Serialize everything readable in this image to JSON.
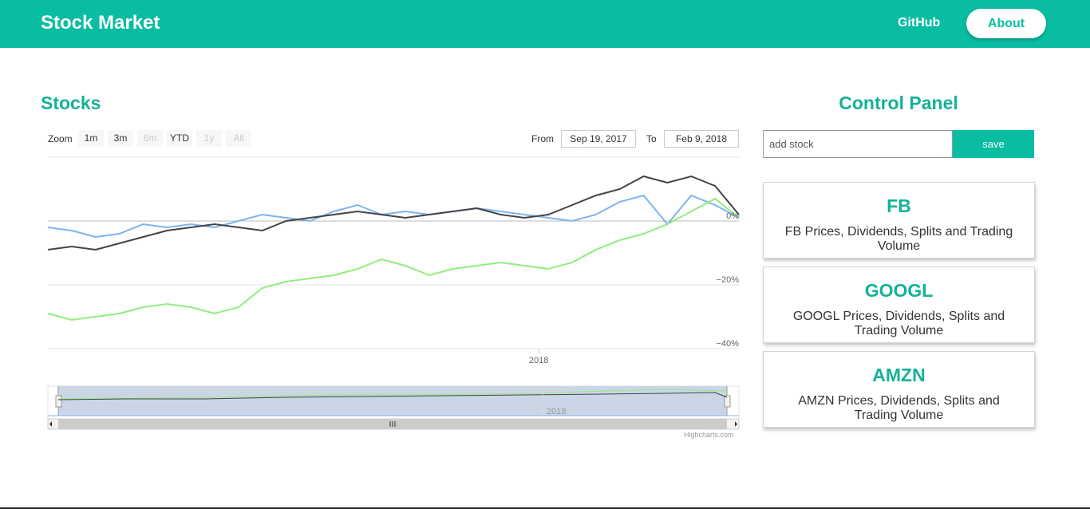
{
  "header": {
    "brand": "Stock Market",
    "nav_github": "GitHub",
    "nav_about": "About"
  },
  "stocks_title": "Stocks",
  "chart": {
    "zoom_label": "Zoom",
    "zoom_buttons": [
      {
        "label": "1m",
        "enabled": true
      },
      {
        "label": "3m",
        "enabled": true
      },
      {
        "label": "6m",
        "enabled": false
      },
      {
        "label": "YTD",
        "enabled": true
      },
      {
        "label": "1y",
        "enabled": false
      },
      {
        "label": "All",
        "enabled": false
      }
    ],
    "from_label": "From",
    "from_value": "Sep 19, 2017",
    "to_label": "To",
    "to_value": "Feb 9, 2018",
    "credits": "Highcharts.com",
    "navigator_label": "2018"
  },
  "chart_data": {
    "type": "line",
    "x": [
      "2017-09-19",
      "2017-09-24",
      "2017-09-29",
      "2017-10-04",
      "2017-10-09",
      "2017-10-14",
      "2017-10-19",
      "2017-10-24",
      "2017-10-29",
      "2017-11-03",
      "2017-11-08",
      "2017-11-13",
      "2017-11-18",
      "2017-11-23",
      "2017-11-28",
      "2017-12-03",
      "2017-12-08",
      "2017-12-13",
      "2017-12-18",
      "2017-12-23",
      "2017-12-28",
      "2018-01-02",
      "2018-01-07",
      "2018-01-12",
      "2018-01-17",
      "2018-01-22",
      "2018-01-27",
      "2018-02-01",
      "2018-02-04",
      "2018-02-09"
    ],
    "series": [
      {
        "color": "#7cb5ec",
        "values": [
          -2,
          -3,
          -5,
          -4,
          -1,
          -2,
          -1,
          -2,
          0,
          2,
          1,
          0,
          3,
          5,
          2,
          3,
          2,
          3,
          4,
          3,
          2,
          1,
          0,
          2,
          6,
          8,
          -1,
          8,
          5,
          1
        ]
      },
      {
        "color": "#434348",
        "values": [
          -9,
          -8,
          -9,
          -7,
          -5,
          -3,
          -2,
          -1,
          -2,
          -3,
          0,
          1,
          2,
          3,
          2,
          1,
          2,
          3,
          4,
          2,
          1,
          2,
          5,
          8,
          10,
          14,
          12,
          14,
          11,
          2
        ]
      },
      {
        "color": "#90ed7d",
        "values": [
          -29,
          -31,
          -30,
          -29,
          -27,
          -26,
          -27,
          -29,
          -27,
          -21,
          -19,
          -18,
          -17,
          -15,
          -12,
          -14,
          -17,
          -15,
          -14,
          -13,
          -14,
          -15,
          -13,
          -9,
          -6,
          -4,
          -1,
          3,
          7,
          1
        ]
      }
    ],
    "ylim": [
      -40,
      20
    ],
    "yticks": [
      "0%",
      "−20%",
      "−40%"
    ],
    "xticks": [
      "2018"
    ],
    "grid": true
  },
  "control_panel": {
    "title": "Control Panel",
    "input_placeholder": "add stock",
    "save_label": "save"
  },
  "stocks": [
    {
      "symbol": "FB",
      "description": "FB Prices, Dividends, Splits and Trading Volume"
    },
    {
      "symbol": "GOOGL",
      "description": "GOOGL Prices, Dividends, Splits and Trading Volume"
    },
    {
      "symbol": "AMZN",
      "description": "AMZN Prices, Dividends, Splits and Trading Volume"
    }
  ]
}
